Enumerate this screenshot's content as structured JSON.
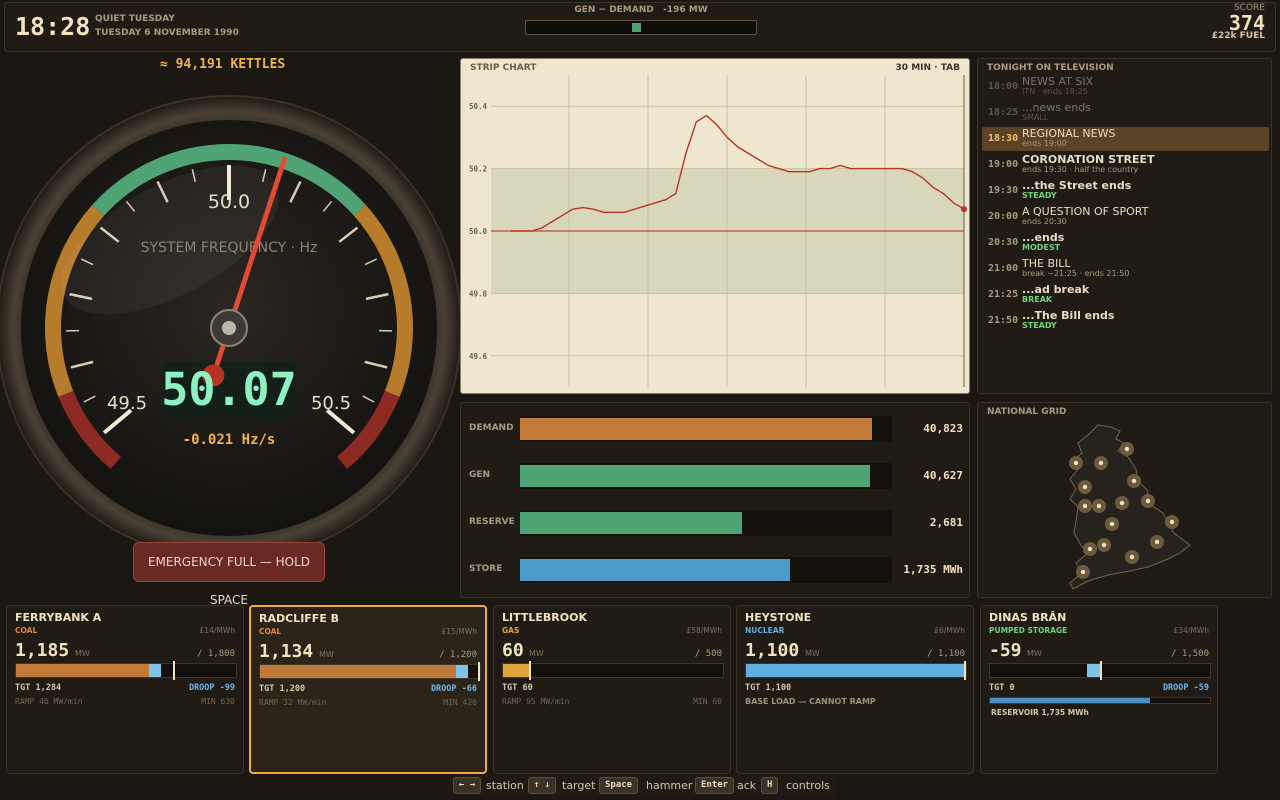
{
  "header": {
    "clock": "18:28",
    "day_label": "QUIET TUESDAY",
    "date_label": "TUESDAY 6 NOVEMBER 1990",
    "balance_title": "GEN − DEMAND",
    "balance_value": "-196 MW",
    "score_label": "SCORE",
    "score_value": "374",
    "fuel_label": "£22k FUEL"
  },
  "gauge": {
    "kettles": "≈ 94,191 KETTLES",
    "title": "SYSTEM FREQUENCY · Hz",
    "center_label": "50.0",
    "low_label": "49.5",
    "high_label": "50.5",
    "readout": "50.07",
    "rate": "-0.021 Hz/s",
    "frequency": 50.07,
    "colors": {
      "green": "#4fa374",
      "amber": "#b77b2c",
      "red": "#8c2a23",
      "needle": "#e24a33",
      "readout": "#8ff0c2"
    }
  },
  "emergency": {
    "label": "EMERGENCY FULL — HOLD SPACE"
  },
  "strip_chart": {
    "title": "STRIP CHART",
    "window": "30 MIN · TAB"
  },
  "chart_data": {
    "type": "line",
    "title": "STRIP CHART",
    "xlabel": "",
    "ylabel": "",
    "ylim": [
      49.5,
      50.5
    ],
    "yticks": [
      "50.4",
      "50.2",
      "50.0",
      "49.8",
      "49.6"
    ],
    "grid": true,
    "band": [
      49.8,
      50.2
    ],
    "series": [
      {
        "values": [
          50.0,
          50.0,
          50.0,
          50.01,
          50.03,
          50.05,
          50.07,
          50.075,
          50.07,
          50.06,
          50.06,
          50.06,
          50.07,
          50.08,
          50.09,
          50.1,
          50.12,
          50.25,
          50.35,
          50.37,
          50.34,
          50.3,
          50.27,
          50.25,
          50.23,
          50.21,
          50.2,
          50.19,
          50.19,
          50.19,
          50.2,
          50.2,
          50.21,
          50.2,
          50.2,
          50.2,
          50.2,
          50.2,
          50.2,
          50.19,
          50.17,
          50.14,
          50.12,
          50.09,
          50.07
        ]
      }
    ]
  },
  "balance_bars": [
    {
      "label": "DEMAND",
      "value": "40,823",
      "fraction": 0.945,
      "color": "#c27a3a"
    },
    {
      "label": "GEN",
      "value": "40,627",
      "fraction": 0.94,
      "color": "#4fa374"
    },
    {
      "label": "RESERVE",
      "value": "2,681",
      "fraction": 0.597,
      "color": "#4fa374"
    },
    {
      "label": "STORE",
      "value": "1,735 MWh",
      "fraction": 0.725,
      "color": "#4b9ac9"
    }
  ],
  "tv": {
    "title": "TONIGHT ON TELEVISION",
    "rows": [
      {
        "time": "18:00",
        "name": "NEWS AT SIX",
        "sub": "ITN · ends 18:25",
        "state": "past",
        "bold": false,
        "tag": false
      },
      {
        "time": "18:25",
        "name": "...news ends",
        "sub": "SMALL",
        "state": "past",
        "bold": false,
        "tag": false
      },
      {
        "time": "18:30",
        "name": "REGIONAL NEWS",
        "sub": "ends 19:00",
        "state": "current",
        "bold": false,
        "tag": false
      },
      {
        "time": "19:00",
        "name": "CORONATION STREET",
        "sub": "ends 19:30 · half the country",
        "state": "future",
        "bold": true,
        "tag": false
      },
      {
        "time": "19:30",
        "name": "...the Street ends",
        "sub": "STEADY",
        "state": "future",
        "bold": true,
        "tag": true
      },
      {
        "time": "20:00",
        "name": "A QUESTION OF SPORT",
        "sub": "ends 20:30",
        "state": "future",
        "bold": false,
        "tag": false
      },
      {
        "time": "20:30",
        "name": "...ends",
        "sub": "MODEST",
        "state": "future",
        "bold": true,
        "tag": true
      },
      {
        "time": "21:00",
        "name": "THE BILL",
        "sub": "break ~21:25 · ends 21:50",
        "state": "future",
        "bold": false,
        "tag": false
      },
      {
        "time": "21:25",
        "name": "...ad break",
        "sub": "BREAK",
        "state": "future",
        "bold": true,
        "tag": true
      },
      {
        "time": "21:50",
        "name": "...The Bill ends",
        "sub": "STEADY",
        "state": "future",
        "bold": true,
        "tag": true
      }
    ]
  },
  "map": {
    "title": "NATIONAL GRID"
  },
  "stations": [
    {
      "name": "FERRYBANK A",
      "type": "COAL",
      "type_color": "#d98a3a",
      "cost": "£14/MWh",
      "output": "1,185",
      "unit": "MW",
      "capacity": "/ 1,800",
      "output_frac": 0.658,
      "target_frac": 0.713,
      "fill_color": "#c27a3a",
      "tgt": "TGT 1,284",
      "droop": "DROOP -99",
      "ramp": "RAMP 46 MW/min",
      "min": "MIN 630",
      "selected": false
    },
    {
      "name": "RADCLIFFE B",
      "type": "COAL",
      "type_color": "#d98a3a",
      "cost": "£15/MWh",
      "output": "1,134",
      "unit": "MW",
      "capacity": "/ 1,200",
      "output_frac": 0.945,
      "target_frac": 1.0,
      "fill_color": "#c27a3a",
      "tgt": "TGT 1,200",
      "droop": "DROOP -66",
      "ramp": "RAMP 32 MW/min",
      "min": "MIN 420",
      "selected": true
    },
    {
      "name": "LITTLEBROOK",
      "type": "GAS",
      "type_color": "#e0a53a",
      "cost": "£58/MWh",
      "output": "60",
      "unit": "MW",
      "capacity": "/ 500",
      "output_frac": 0.12,
      "target_frac": 0.12,
      "fill_color": "#e0a53a",
      "tgt": "TGT 60",
      "droop": "",
      "ramp": "RAMP 95 MW/min",
      "min": "MIN 60",
      "selected": false
    },
    {
      "name": "HEYSTONE",
      "type": "NUCLEAR",
      "type_color": "#5fb0e0",
      "cost": "£6/MWh",
      "output": "1,100",
      "unit": "MW",
      "capacity": "/ 1,100",
      "output_frac": 1.0,
      "target_frac": 1.0,
      "fill_color": "#5fb0e0",
      "tgt": "TGT 1,100",
      "droop": "",
      "note": "BASE LOAD — CANNOT RAMP",
      "selected": false
    },
    {
      "name": "DINAS BRÂN",
      "type": "PUMPED STORAGE",
      "type_color": "#6fd37c",
      "cost": "£34/MWh",
      "output": "-59",
      "unit": "MW",
      "capacity": "/ 1,500",
      "output_frac": -0.04,
      "target_frac": 0.5,
      "fill_color": "#7ec2e8",
      "tgt": "TGT 0",
      "droop": "DROOP -59",
      "reservoir": "RESERVOIR 1,735 MWh",
      "reservoir_frac": 0.725,
      "selected": false
    }
  ],
  "help": [
    {
      "key": "← →",
      "desc": "station"
    },
    {
      "key": "↑ ↓",
      "desc": "target"
    },
    {
      "key": "Space",
      "desc": "hammer"
    },
    {
      "key": "Enter",
      "desc": "ack"
    },
    {
      "key": "H",
      "desc": "controls"
    }
  ]
}
